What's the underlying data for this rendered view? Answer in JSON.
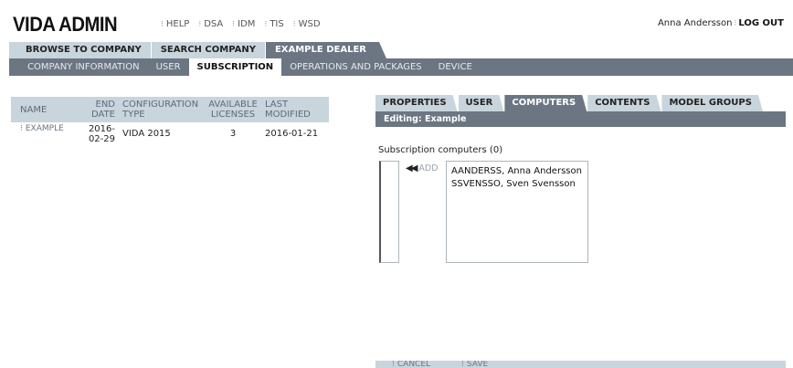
{
  "header": {
    "logo": "VIDA ADMIN",
    "links": [
      "HELP",
      "DSA",
      "IDM",
      "TIS",
      "WSD"
    ],
    "user_name": "Anna Andersson",
    "logout_label": "LOG OUT"
  },
  "primary_tabs": [
    "BROWSE TO COMPANY",
    "SEARCH COMPANY",
    "EXAMPLE DEALER"
  ],
  "secondary_tabs": [
    "COMPANY INFORMATION",
    "USER",
    "SUBSCRIPTION",
    "OPERATIONS AND PACKAGES",
    "DEVICE"
  ],
  "table": {
    "headers": {
      "name": "NAME",
      "end_date": [
        "END",
        "DATE"
      ],
      "config_type": [
        "CONFIGURATION",
        "TYPE"
      ],
      "licenses": [
        "AVAILABLE",
        "LICENSES"
      ],
      "last_modified": [
        "LAST",
        "MODIFIED"
      ]
    },
    "rows": [
      {
        "name": "EXAMPLE",
        "end_date": [
          "2016-",
          "02-29"
        ],
        "config_type": "VIDA 2015",
        "licenses": "3",
        "last_modified": "2016-01-21"
      }
    ]
  },
  "panel": {
    "tabs": [
      "PROPERTIES",
      "USER",
      "COMPUTERS",
      "CONTENTS",
      "MODEL GROUPS"
    ],
    "editing": "Editing: Example",
    "subtitle": "Subscription computers (0)",
    "add_label": "ADD",
    "available_computers": [
      "AANDERSS, Anna Andersson",
      "SSVENSSO, Sven Svensson"
    ],
    "cancel_label": "CANCEL",
    "save_label": "SAVE"
  },
  "icons": {
    "bullet": "bullet-icon",
    "add": "double-chevron-left-icon"
  },
  "colors": {
    "tab_light": "#c9d5dc",
    "tab_dark": "#6b7682"
  }
}
